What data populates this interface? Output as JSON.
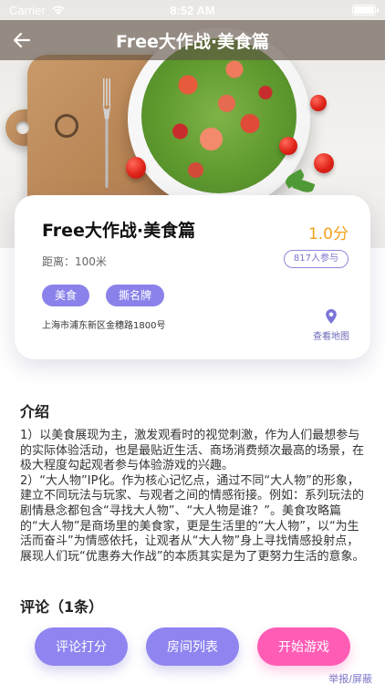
{
  "status_bar": {
    "carrier": "Carrier",
    "time": "8:52 AM"
  },
  "navbar": {
    "title": "Free大作战·美食篇"
  },
  "card": {
    "title": "Free大作战·美食篇",
    "score": "1.0分",
    "distance": "距离：100米",
    "participants": "817人参与",
    "tags": [
      "美食",
      "撕名牌"
    ],
    "address": "上海市浦东新区金穗路1800号",
    "map_label": "查看地图"
  },
  "intro": {
    "heading": "介绍",
    "body": "1）以美食展现为主，激发观看时的视觉刺激，作为人们最想参与的实际体验活动，也是最贴近生活、商场消费频次最高的场景，在极大程度勾起观者参与体验游戏的兴趣。\n2）“大人物”IP化。作为核心记忆点，通过不同“大人物”的形象，建立不同玩法与玩家、与观者之间的情感衔接。例如：系列玩法的剧情悬念都包含“寻找大人物”、“大人物是谁？”。美食攻略篇的“大人物”是商场里的美食家，更是生活里的“大人物”，以“为生活而奋斗”为情感依托，让观者从“大人物”身上寻找情感投射点，展现人们玩“优惠券大作战”的本质其实是为了更努力生活的意象。"
  },
  "comments": {
    "heading": "评论（1条）"
  },
  "buttons": {
    "rate": "评论打分",
    "rooms": "房间列表",
    "start": "开始游戏"
  },
  "report": "举报/屏蔽",
  "colors": {
    "accent": "#8f84f0",
    "start": "#ff5cb5",
    "score": "#f2a11b"
  },
  "icons": {
    "back": "back-arrow-icon",
    "map": "map-pin-icon",
    "wifi": "wifi-icon",
    "battery": "battery-icon"
  }
}
